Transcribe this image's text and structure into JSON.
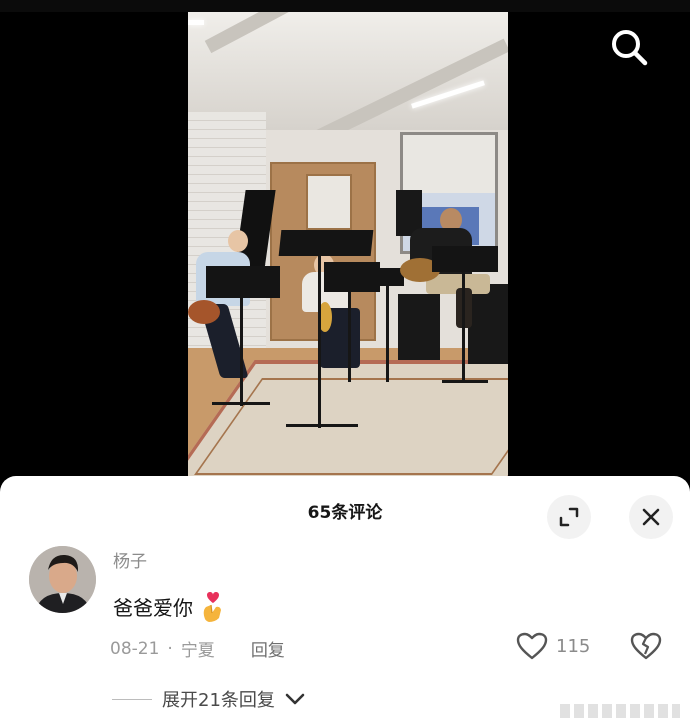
{
  "icons": {
    "search": "search-icon",
    "expand": "expand-icon",
    "close": "close-icon",
    "heart": "heart-icon",
    "dislike": "broken-heart-icon",
    "chevron": "chevron-down-icon",
    "emoji": "finger-heart-emoji"
  },
  "comments_panel": {
    "title": "65条评论",
    "comment": {
      "username": "杨子",
      "text": "爸爸爱你",
      "date": "08-21",
      "separator": "·",
      "location": "宁夏",
      "reply_label": "回复",
      "like_count": "115",
      "expand_replies_label": "展开21条回复"
    }
  },
  "colors": {
    "panel_bg": "#ffffff",
    "page_bg": "#000000",
    "muted_text": "#8b8b8b"
  }
}
